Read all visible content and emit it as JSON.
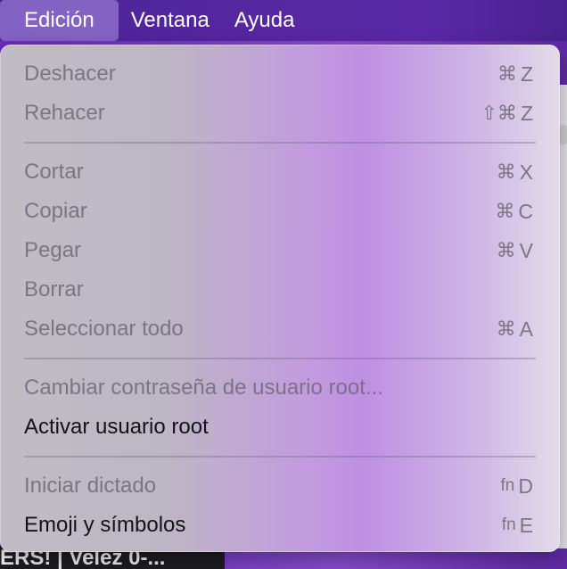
{
  "menubar": {
    "items": [
      {
        "label": "Edición",
        "active": true
      },
      {
        "label": "Ventana",
        "active": false
      },
      {
        "label": "Ayuda",
        "active": false
      }
    ]
  },
  "background": {
    "bottom_text": "ERS! | Velez 0-..."
  },
  "menu": {
    "groups": [
      [
        {
          "label": "Deshacer",
          "enabled": false,
          "modifiers": "⌘",
          "key": "Z"
        },
        {
          "label": "Rehacer",
          "enabled": false,
          "modifiers": "⇧⌘",
          "key": "Z"
        }
      ],
      [
        {
          "label": "Cortar",
          "enabled": false,
          "modifiers": "⌘",
          "key": "X"
        },
        {
          "label": "Copiar",
          "enabled": false,
          "modifiers": "⌘",
          "key": "C"
        },
        {
          "label": "Pegar",
          "enabled": false,
          "modifiers": "⌘",
          "key": "V"
        },
        {
          "label": "Borrar",
          "enabled": false,
          "modifiers": "",
          "key": ""
        },
        {
          "label": "Seleccionar todo",
          "enabled": false,
          "modifiers": "⌘",
          "key": "A"
        }
      ],
      [
        {
          "label": "Cambiar contraseña de usuario root...",
          "enabled": false,
          "modifiers": "",
          "key": ""
        },
        {
          "label": "Activar usuario root",
          "enabled": true,
          "modifiers": "",
          "key": ""
        }
      ],
      [
        {
          "label": "Iniciar dictado",
          "enabled": false,
          "modifiers": "fn",
          "key": "D"
        },
        {
          "label": "Emoji y símbolos",
          "enabled": true,
          "modifiers": "fn",
          "key": "E"
        }
      ]
    ]
  },
  "colors": {
    "menubar": "#55279f",
    "disabled_text": "#6f6a78",
    "enabled_text": "#141218"
  }
}
